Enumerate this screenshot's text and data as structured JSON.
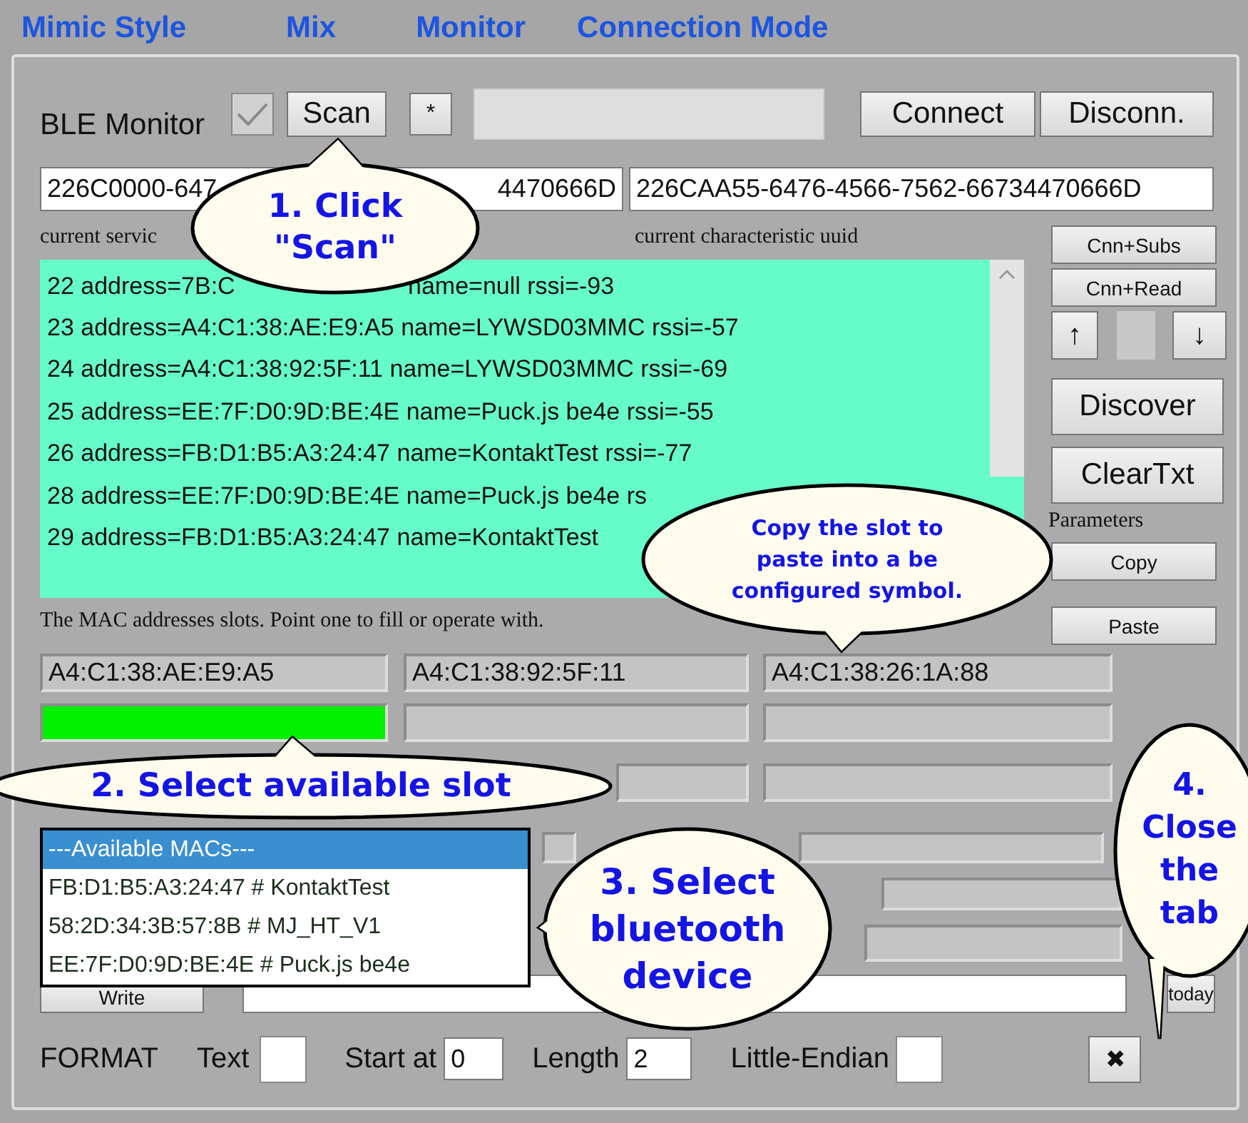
{
  "tabs": [
    {
      "label": "Mimic Style"
    },
    {
      "label": "Mix"
    },
    {
      "label": "Monitor"
    },
    {
      "label": "Connection Mode"
    }
  ],
  "toolbar": {
    "title": "BLE Monitor",
    "checked": true,
    "scan_button": "Scan",
    "star_button": "*",
    "connect_button": "Connect",
    "disconnect_button": "Disconn."
  },
  "uuids": {
    "service_visible_start": "226C0000-647",
    "service_visible_end": "4470666D",
    "characteristic": "226CAA55-6476-4566-7562-66734470666D",
    "service_label": "current servic",
    "characteristic_label": "current characteristic uuid"
  },
  "device_log": [
    [
      "22 address=7B:C",
      "name=null rssi=-93"
    ],
    [
      "23 address=A4:C1:38:AE:E9:A5 name=LYWSD03MMC rssi=-57"
    ],
    [
      "24 address=A4:C1:38:92:5F:11 name=LYWSD03MMC rssi=-69"
    ],
    [
      "25 address=EE:7F:D0:9D:BE:4E name=Puck.js be4e rssi=-55"
    ],
    [
      "26 address=FB:D1:B5:A3:24:47 name=KontaktTest rssi=-77"
    ],
    [
      "28 address=EE:7F:D0:9D:BE:4E name=Puck.js be4e rs"
    ],
    [
      "29 address=FB:D1:B5:A3:24:47 name=KontaktTest"
    ]
  ],
  "side_buttons": {
    "cnn_subs": "Cnn+Subs",
    "cnn_read": "Cnn+Read",
    "up": "↑",
    "down": "↓",
    "discover": "Discover",
    "clear": "ClearTxt",
    "parameters_label": "Parameters",
    "copy": "Copy",
    "paste": "Paste"
  },
  "slots_hint": "The MAC addresses slots. Point one to fill or operate with.",
  "slots": [
    {
      "value": "A4:C1:38:AE:E9:A5",
      "selected": false
    },
    {
      "value": "A4:C1:38:92:5F:11",
      "selected": false
    },
    {
      "value": "A4:C1:38:26:1A:88",
      "selected": false
    }
  ],
  "slots_row_2": [
    {
      "selected": true
    },
    {
      "selected": false
    },
    {
      "selected": false
    }
  ],
  "mac_dropdown": [
    {
      "label": "---Available MACs---",
      "selected": true
    },
    {
      "label": "FB:D1:B5:A3:24:47 # KontaktTest",
      "selected": false
    },
    {
      "label": "58:2D:34:3B:57:8B # MJ_HT_V1",
      "selected": false
    },
    {
      "label": "EE:7F:D0:9D:BE:4E # Puck.js be4e",
      "selected": false
    }
  ],
  "write_button": "Write",
  "today_button": "today",
  "format": {
    "label": "FORMAT",
    "text_label": "Text",
    "text_checked": false,
    "start_label": "Start at",
    "start_value": "0",
    "length_label": "Length",
    "length_value": "2",
    "little_endian_label": "Little-Endian",
    "little_endian_checked": false
  },
  "close_button": "✖",
  "callouts": [
    {
      "text": "1. Click\n\"Scan\""
    },
    {
      "text": "Copy the slot to\npaste into a be\nconfigured symbol."
    },
    {
      "text": "2. Select available slot"
    },
    {
      "text": "3. Select\nbluetooth\ndevice"
    },
    {
      "text": "4.\nClose\nthe\ntab"
    }
  ]
}
